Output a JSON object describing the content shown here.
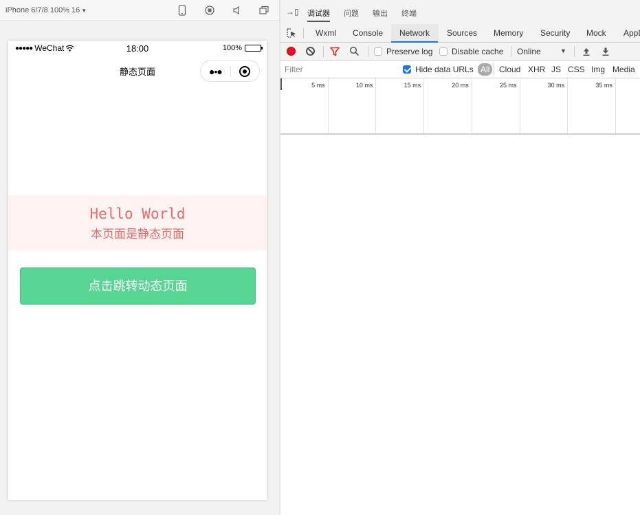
{
  "simulator": {
    "device_label": "iPhone 6/7/8 100% 16",
    "tools": [
      "phone-icon",
      "record-icon",
      "volume-icon",
      "window-icon"
    ]
  },
  "phone": {
    "status": {
      "carrier": "WeChat",
      "time": "18:00",
      "battery": "100%",
      "battery_level": 1.0
    },
    "nav_title": "静态页面",
    "hello": "Hello World",
    "subtitle": "本页面是静态页面",
    "button_label": "点击跳转动态页面",
    "colors": {
      "hello_text": "#e86a6a",
      "hello_bg": "#fff4f2",
      "button_bg": "#57d592"
    }
  },
  "devtools": {
    "top_tabs": [
      "调试器",
      "问题",
      "输出",
      "终端"
    ],
    "active_top_tab": "调试器",
    "tabs": [
      "Wxml",
      "Console",
      "Network",
      "Sources",
      "Memory",
      "Security",
      "Mock",
      "AppD"
    ],
    "active_tab": "Network",
    "preserve_log": "Preserve log",
    "disable_cache": "Disable cache",
    "throttle": "Online",
    "filter_placeholder": "Filter",
    "hide_data_urls": "Hide data URLs",
    "types": [
      "All",
      "Cloud",
      "XHR",
      "JS",
      "CSS",
      "Img",
      "Media"
    ],
    "active_type": "All",
    "timeline_ticks": [
      "5 ms",
      "10 ms",
      "15 ms",
      "20 ms",
      "25 ms",
      "30 ms",
      "35 ms"
    ],
    "colors": {
      "accent": "#1a73e8",
      "record": "#e3112b"
    }
  }
}
